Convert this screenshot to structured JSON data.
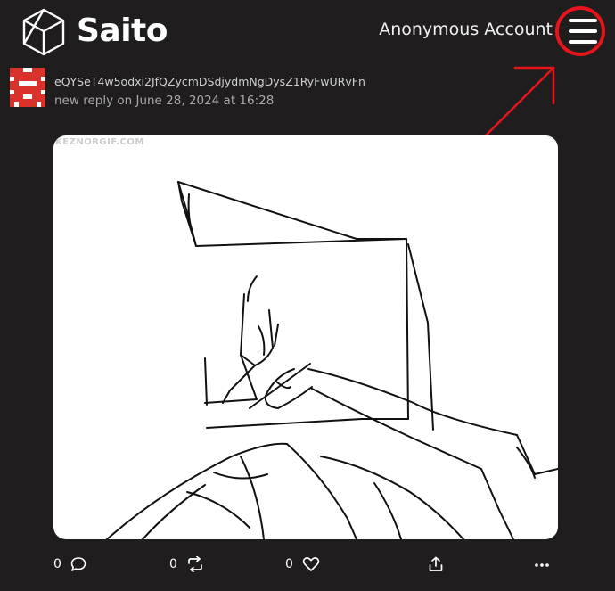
{
  "header": {
    "brand": "Saito",
    "account_label": "Anonymous Account"
  },
  "post": {
    "author": "eQYSeT4w5odxi2JfQZycmDSdjydmNgDysZ1RyFwURvFn",
    "meta": "new reply on June 28, 2024 at 16:28",
    "watermark": "KEZNORGIF.COM"
  },
  "actions": {
    "comments_count": "0",
    "retweets_count": "0",
    "likes_count": "0"
  },
  "colors": {
    "background": "#201d1e",
    "annotation_red": "#e8141b",
    "avatar_red": "#d9322b"
  },
  "icons": [
    "saito-cube-logo-icon",
    "hamburger-menu-icon",
    "comment-icon",
    "retweet-icon",
    "heart-icon",
    "share-icon",
    "more-icon"
  ]
}
